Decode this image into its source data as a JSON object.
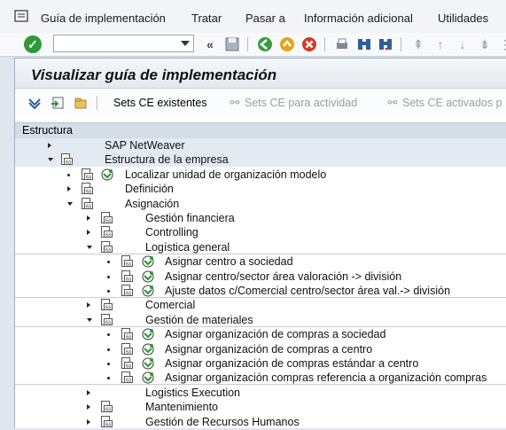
{
  "menu": {
    "guia": "Guía de implementación",
    "tratar": "Tratar",
    "pasar": "Pasar a",
    "info": "Información adicional",
    "util": "Utilidades"
  },
  "toolbar": {
    "command_value": "",
    "back_symbol": "«"
  },
  "title": "Visualizar guía de implementación",
  "app_toolbar": {
    "sets_existentes": "Sets CE existentes",
    "sets_actividad": "Sets CE para actividad",
    "sets_activados": "Sets CE activados p"
  },
  "tree_header": "Estructura",
  "tree": [
    {
      "label": "SAP NetWeaver"
    },
    {
      "label": "Estructura de la empresa"
    },
    {
      "label": "Localizar unidad de organización modelo"
    },
    {
      "label": "Definición"
    },
    {
      "label": "Asignación"
    },
    {
      "label": "Gestión financiera"
    },
    {
      "label": "Controlling"
    },
    {
      "label": "Logística general"
    },
    {
      "label": "Asignar centro a sociedad"
    },
    {
      "label": "Asignar centro/sector área valoración -> división"
    },
    {
      "label": "Ajuste datos c/Comercial centro/sector área val.-> división"
    },
    {
      "label": "Comercial"
    },
    {
      "label": "Gestión de materiales"
    },
    {
      "label": "Asignar organización de compras a sociedad"
    },
    {
      "label": "Asignar organización de compras a centro"
    },
    {
      "label": "Asignar organización de compras estándar a centro"
    },
    {
      "label": "Asignar organización compras referencia a organización compras"
    },
    {
      "label": "Logistics Execution"
    },
    {
      "label": "Mantenimiento"
    },
    {
      "label": "Gestión de Recursos Humanos"
    }
  ]
}
